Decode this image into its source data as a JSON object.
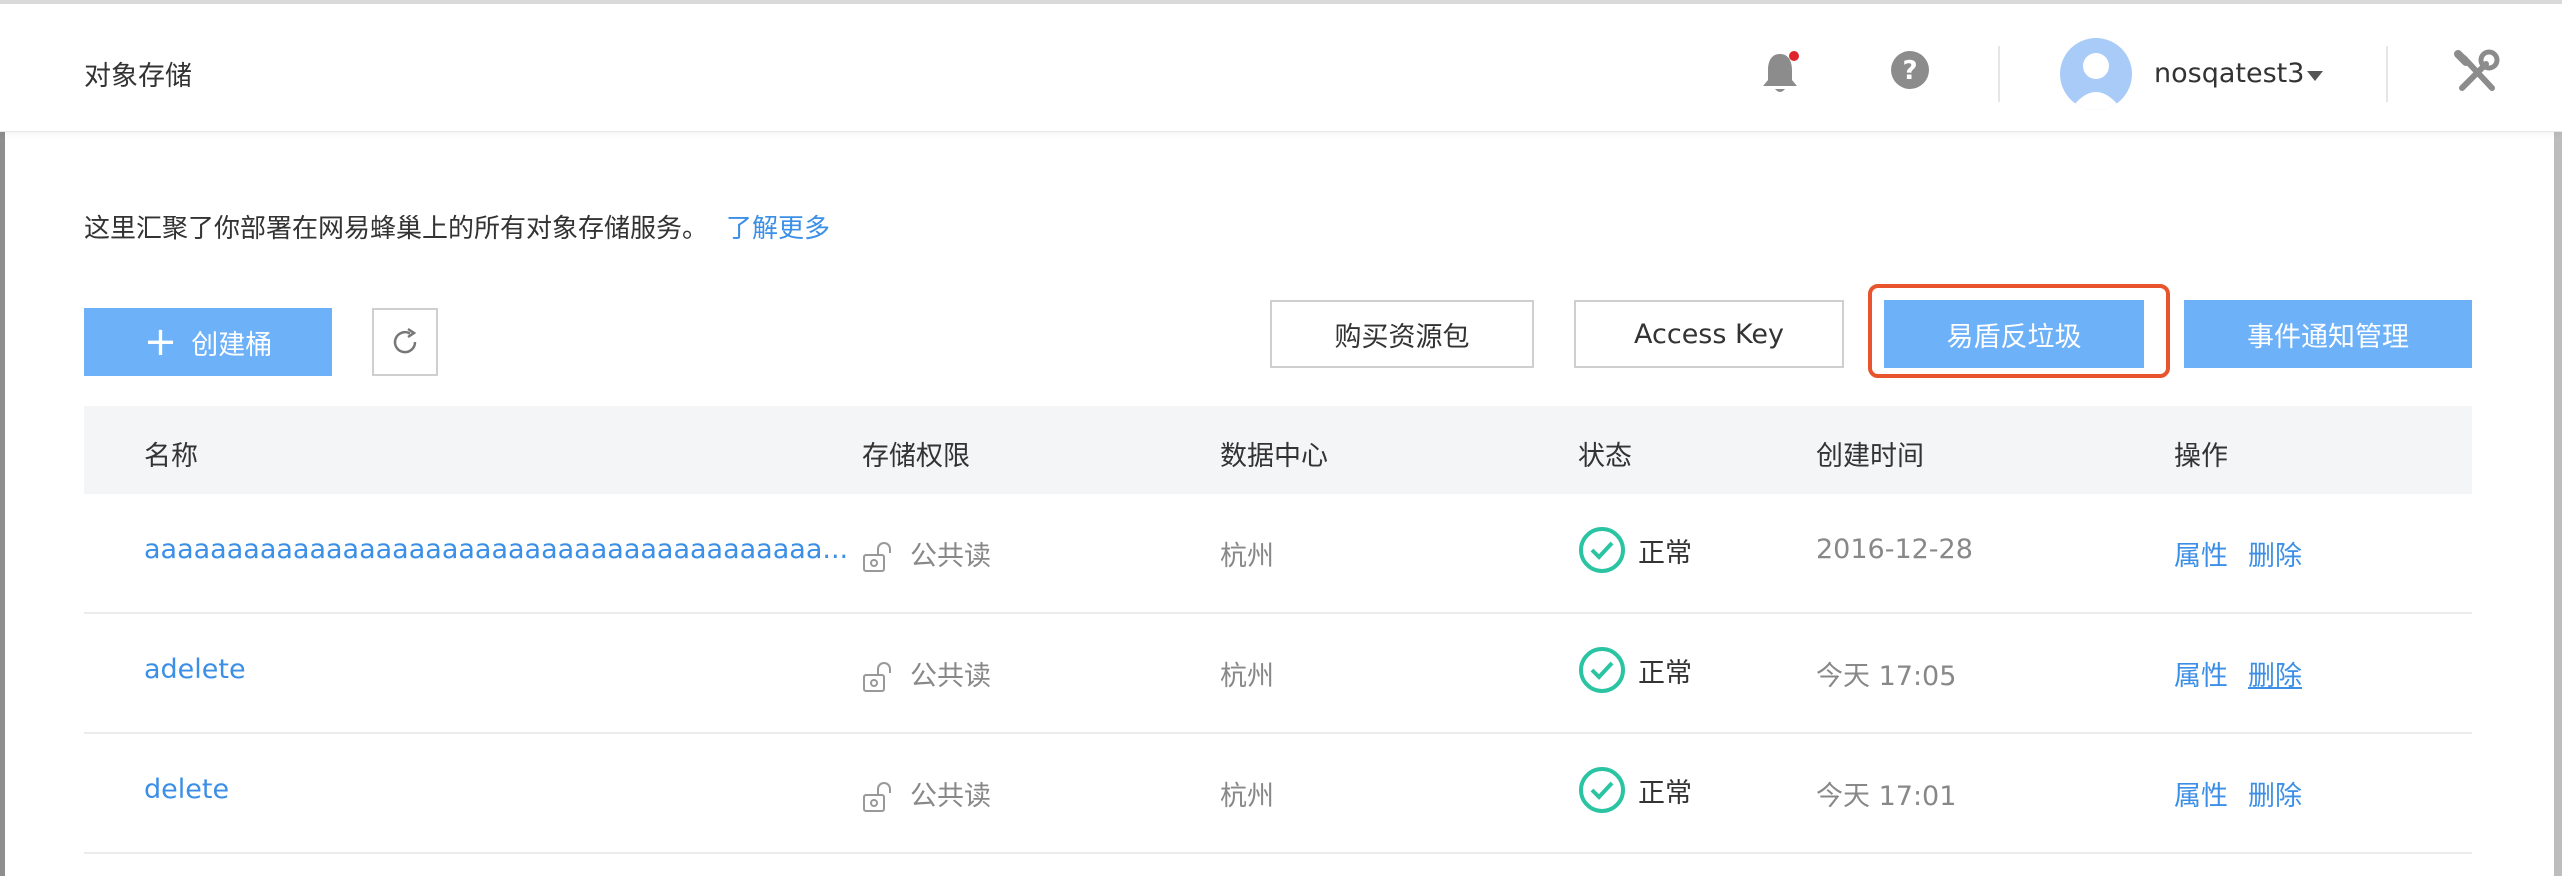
{
  "header": {
    "app_title": "对象存储",
    "username": "nosqatest3",
    "icons": [
      "bell-icon",
      "help-icon",
      "user-avatar",
      "caret-down-icon",
      "tools-icon"
    ]
  },
  "intro": {
    "text": "这里汇聚了你部署在网易蜂巢上的所有对象存储服务。",
    "link": "了解更多"
  },
  "toolbar": {
    "create_label": "创建桶",
    "buy_label": "购买资源包",
    "access_key_label": "Access Key",
    "anti_spam_label": "易盾反垃圾",
    "event_label": "事件通知管理"
  },
  "table": {
    "headers": [
      "名称",
      "存储权限",
      "数据中心",
      "状态",
      "创建时间",
      "操作"
    ],
    "rows": [
      {
        "name": "aaaaaaaaaaaaaaaaaaaaaaaaaaaaaaaaaaaaaaaaa...",
        "perm": "公共读",
        "dc": "杭州",
        "status": "正常",
        "time": "2016-12-28",
        "op1": "属性",
        "op2": "删除"
      },
      {
        "name": "adelete",
        "perm": "公共读",
        "dc": "杭州",
        "status": "正常",
        "time": "今天 17:05",
        "op1": "属性",
        "op2": "删除"
      },
      {
        "name": "delete",
        "perm": "公共读",
        "dc": "杭州",
        "status": "正常",
        "time": "今天 17:01",
        "op1": "属性",
        "op2": "删除"
      }
    ]
  },
  "colors": {
    "primary": "#6db1f8",
    "link": "#3b8fe6",
    "success": "#2bc4a3",
    "highlight": "#e8542c"
  }
}
